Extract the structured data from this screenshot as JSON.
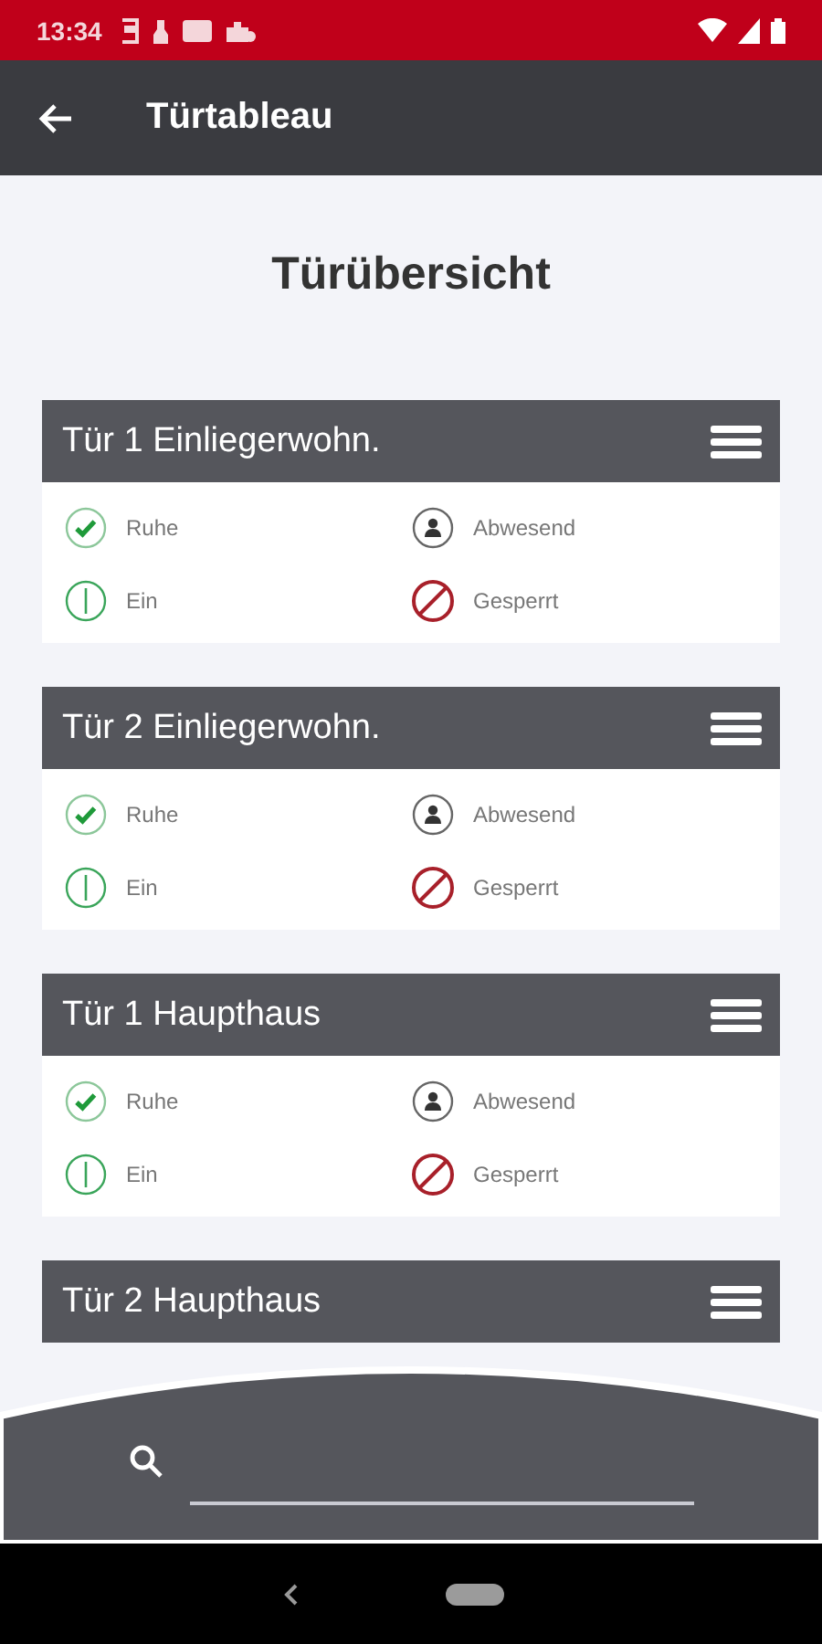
{
  "status_bar": {
    "time": "13:34"
  },
  "app_bar": {
    "title": "Türtableau"
  },
  "heading": "Türübersicht",
  "doors": [
    {
      "name": "Tür 1 Einliegerwohn.",
      "statuses": [
        {
          "kind": "ok",
          "label": "Ruhe"
        },
        {
          "kind": "absent",
          "label": "Abwesend"
        },
        {
          "kind": "power",
          "label": "Ein"
        },
        {
          "kind": "blocked",
          "label": "Gesperrt"
        }
      ]
    },
    {
      "name": "Tür 2 Einliegerwohn.",
      "statuses": [
        {
          "kind": "ok",
          "label": "Ruhe"
        },
        {
          "kind": "absent",
          "label": "Abwesend"
        },
        {
          "kind": "power",
          "label": "Ein"
        },
        {
          "kind": "blocked",
          "label": "Gesperrt"
        }
      ]
    },
    {
      "name": "Tür 1 Haupthaus",
      "statuses": [
        {
          "kind": "ok",
          "label": "Ruhe"
        },
        {
          "kind": "absent",
          "label": "Abwesend"
        },
        {
          "kind": "power",
          "label": "Ein"
        },
        {
          "kind": "blocked",
          "label": "Gesperrt"
        }
      ]
    },
    {
      "name": "Tür 2 Haupthaus"
    }
  ]
}
